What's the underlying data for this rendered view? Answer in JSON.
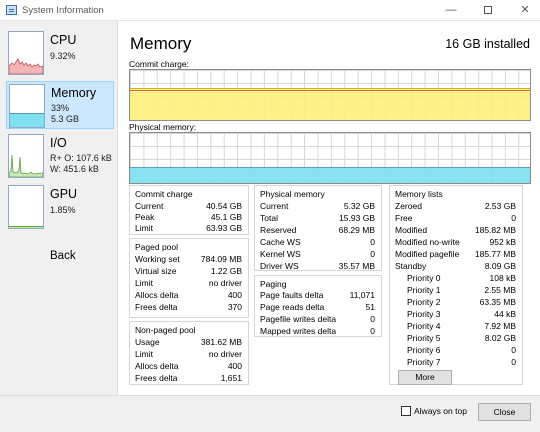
{
  "window": {
    "title": "System Information",
    "minimize_glyph": "—",
    "close_glyph": "✕"
  },
  "sidebar": {
    "cpu": {
      "title": "CPU",
      "sub": "9.32%"
    },
    "memory": {
      "title": "Memory",
      "sub1": "33%",
      "sub2": "5.3 GB"
    },
    "io": {
      "title": "I/O",
      "sub1": "R+ O: 107.6 kB",
      "sub2": "W: 451.6 kB"
    },
    "gpu": {
      "title": "GPU",
      "sub": "1.85%"
    },
    "back": "Back"
  },
  "main": {
    "title": "Memory",
    "installed": "16 GB installed",
    "commit_label": "Commit charge:",
    "physical_label": "Physical memory:",
    "commit_fill_fraction": 0.64,
    "physical_fill_fraction": 0.33
  },
  "commit_charge": {
    "title": "Commit charge",
    "rows": [
      {
        "k": "Current",
        "v": "40.54 GB"
      },
      {
        "k": "Peak",
        "v": "45.1 GB"
      },
      {
        "k": "Limit",
        "v": "63.93 GB"
      }
    ]
  },
  "paged_pool": {
    "title": "Paged pool",
    "rows": [
      {
        "k": "Working set",
        "v": "784.09 MB"
      },
      {
        "k": "Virtual size",
        "v": "1.22 GB"
      },
      {
        "k": "Limit",
        "v": "no driver"
      },
      {
        "k": "Allocs delta",
        "v": "400"
      },
      {
        "k": "Frees delta",
        "v": "370"
      }
    ]
  },
  "nonpaged_pool": {
    "title": "Non-paged pool",
    "rows": [
      {
        "k": "Usage",
        "v": "381.62 MB"
      },
      {
        "k": "Limit",
        "v": "no driver"
      },
      {
        "k": "Allocs delta",
        "v": "400"
      },
      {
        "k": "Frees delta",
        "v": "1,651"
      }
    ]
  },
  "physical_memory": {
    "title": "Physical memory",
    "rows": [
      {
        "k": "Current",
        "v": "5.32 GB"
      },
      {
        "k": "Total",
        "v": "15.93 GB"
      },
      {
        "k": "Reserved",
        "v": "68.29 MB"
      },
      {
        "k": "Cache WS",
        "v": "0"
      },
      {
        "k": "Kernel WS",
        "v": "0"
      },
      {
        "k": "Driver WS",
        "v": "35.57 MB"
      }
    ]
  },
  "paging": {
    "title": "Paging",
    "rows": [
      {
        "k": "Page faults delta",
        "v": "11,071"
      },
      {
        "k": "Page reads delta",
        "v": "51"
      },
      {
        "k": "Pagefile writes delta",
        "v": "0"
      },
      {
        "k": "Mapped writes delta",
        "v": "0"
      }
    ]
  },
  "memory_lists": {
    "title": "Memory lists",
    "rows": [
      {
        "k": "Zeroed",
        "v": "2.53 GB"
      },
      {
        "k": "Free",
        "v": "0"
      },
      {
        "k": "Modified",
        "v": "185.82 MB"
      },
      {
        "k": "Modified no-write",
        "v": "952 kB"
      },
      {
        "k": "Modified pagefile",
        "v": "185.77 MB"
      },
      {
        "k": "Standby",
        "v": "8.09 GB"
      }
    ],
    "priorities": [
      {
        "k": "Priority 0",
        "v": "108 kB"
      },
      {
        "k": "Priority 1",
        "v": "2.55 MB"
      },
      {
        "k": "Priority 2",
        "v": "63.35 MB"
      },
      {
        "k": "Priority 3",
        "v": "44 kB"
      },
      {
        "k": "Priority 4",
        "v": "7.92 MB"
      },
      {
        "k": "Priority 5",
        "v": "8.02 GB"
      },
      {
        "k": "Priority 6",
        "v": "0"
      },
      {
        "k": "Priority 7",
        "v": "0"
      }
    ],
    "more_label": "More"
  },
  "footer": {
    "always_on_top": "Always on top",
    "always_on_top_checked": false,
    "close": "Close"
  },
  "colors": {
    "selected_bg": "#cce8ff",
    "commit_fill": "#fbf17e",
    "physical_fill": "#7fe0ef",
    "cpu_graph": "#e07a7a",
    "memory_graph": "#7fe0ef",
    "io_graph": "#9ad27e"
  }
}
